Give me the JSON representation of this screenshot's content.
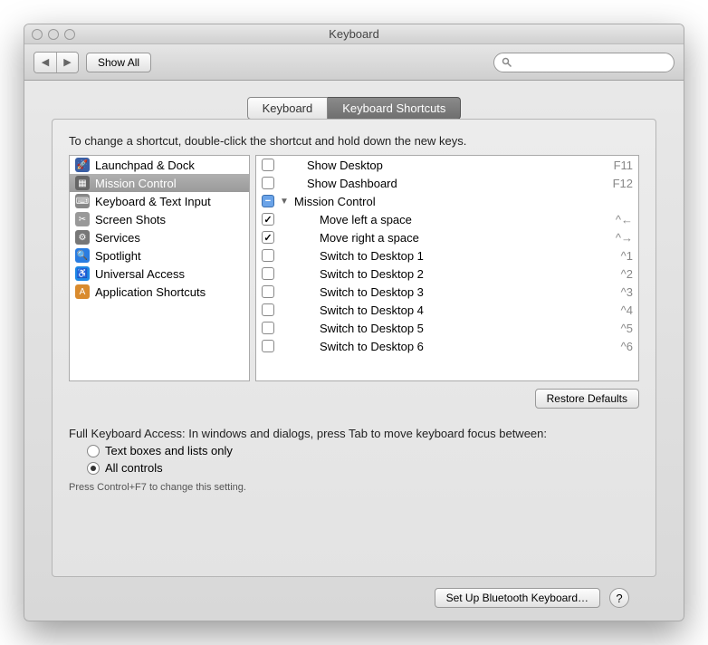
{
  "window_title": "Keyboard",
  "toolbar": {
    "back_icon": "◀",
    "forward_icon": "▶",
    "show_all": "Show All"
  },
  "tabs": [
    {
      "label": "Keyboard",
      "active": false
    },
    {
      "label": "Keyboard Shortcuts",
      "active": true
    }
  ],
  "instruction": "To change a shortcut, double-click the shortcut and hold down the new keys.",
  "categories": [
    {
      "label": "Launchpad & Dock",
      "icon": "🚀",
      "bg": "#3a5fa5",
      "selected": false
    },
    {
      "label": "Mission Control",
      "icon": "▦",
      "bg": "#666",
      "selected": true
    },
    {
      "label": "Keyboard & Text Input",
      "icon": "⌨",
      "bg": "#888",
      "selected": false
    },
    {
      "label": "Screen Shots",
      "icon": "✂",
      "bg": "#999",
      "selected": false
    },
    {
      "label": "Services",
      "icon": "⚙",
      "bg": "#777",
      "selected": false
    },
    {
      "label": "Spotlight",
      "icon": "🔍",
      "bg": "#2a7de1",
      "selected": false
    },
    {
      "label": "Universal Access",
      "icon": "♿",
      "bg": "#1e88e5",
      "selected": false
    },
    {
      "label": "Application Shortcuts",
      "icon": "A",
      "bg": "#d98b2e",
      "selected": false
    }
  ],
  "shortcuts": [
    {
      "checked": false,
      "mixed": false,
      "disclosure": "",
      "label": "Show Desktop",
      "indent": 1,
      "keys": "F11"
    },
    {
      "checked": false,
      "mixed": false,
      "disclosure": "",
      "label": "Show Dashboard",
      "indent": 1,
      "keys": "F12"
    },
    {
      "checked": false,
      "mixed": true,
      "disclosure": "▼",
      "label": "Mission Control",
      "indent": 0,
      "keys": ""
    },
    {
      "checked": true,
      "mixed": false,
      "disclosure": "",
      "label": "Move left a space",
      "indent": 2,
      "keys": "^←"
    },
    {
      "checked": true,
      "mixed": false,
      "disclosure": "",
      "label": "Move right a space",
      "indent": 2,
      "keys": "^→"
    },
    {
      "checked": false,
      "mixed": false,
      "disclosure": "",
      "label": "Switch to Desktop 1",
      "indent": 2,
      "keys": "^1"
    },
    {
      "checked": false,
      "mixed": false,
      "disclosure": "",
      "label": "Switch to Desktop 2",
      "indent": 2,
      "keys": "^2"
    },
    {
      "checked": false,
      "mixed": false,
      "disclosure": "",
      "label": "Switch to Desktop 3",
      "indent": 2,
      "keys": "^3"
    },
    {
      "checked": false,
      "mixed": false,
      "disclosure": "",
      "label": "Switch to Desktop 4",
      "indent": 2,
      "keys": "^4"
    },
    {
      "checked": false,
      "mixed": false,
      "disclosure": "",
      "label": "Switch to Desktop 5",
      "indent": 2,
      "keys": "^5"
    },
    {
      "checked": false,
      "mixed": false,
      "disclosure": "",
      "label": "Switch to Desktop 6",
      "indent": 2,
      "keys": "^6"
    }
  ],
  "restore_defaults": "Restore Defaults",
  "fka": {
    "label": "Full Keyboard Access: In windows and dialogs, press Tab to move keyboard focus between:",
    "option1": "Text boxes and lists only",
    "option2": "All controls",
    "selected": 1,
    "hint": "Press Control+F7 to change this setting."
  },
  "bluetooth_button": "Set Up Bluetooth Keyboard…",
  "help": "?"
}
